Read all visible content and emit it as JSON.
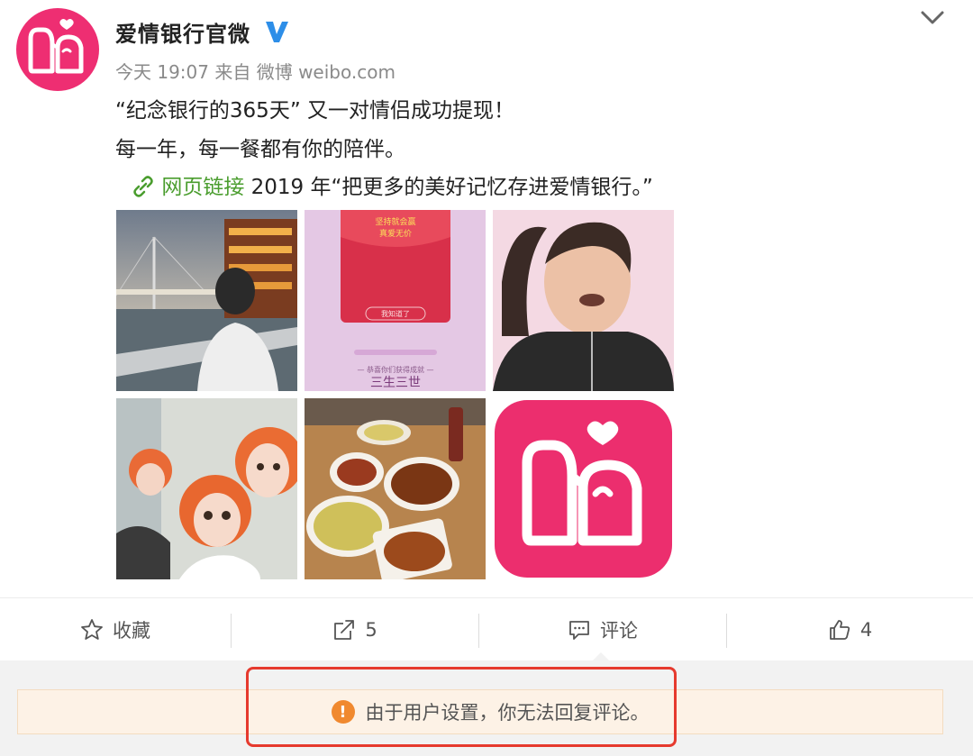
{
  "post": {
    "username": "爱情银行官微",
    "verified_icon": "verified-v-icon",
    "meta": "今天 19:07 来自 微博 weibo.com",
    "text_line1": "“纪念银行的365天” 又一对情侣成功提现！",
    "text_line2": "每一年，每一餐都有你的陪伴。",
    "link_label": "网页链接",
    "link_rest": " 2019 年“把更多的美好记忆存进爱情银行。”",
    "photos": {
      "p2_top": "坚持就会赢",
      "p2_top2": "真爱无价",
      "p2_btn": "我知道了",
      "p2_sub": "— 恭喜你们获得成就 —",
      "p2_title": "三生三世"
    }
  },
  "actions": {
    "favorite_label": "收藏",
    "repost_count": "5",
    "comment_label": "评论",
    "like_count": "4"
  },
  "notice": {
    "icon": "!",
    "text": "由于用户设置，你无法回复评论。"
  },
  "colors": {
    "brand": "#ee2e72",
    "link": "#4a9d2e",
    "notice_bg": "#fdf2e6",
    "warn": "#f0892f",
    "highlight": "#e63a2e"
  }
}
